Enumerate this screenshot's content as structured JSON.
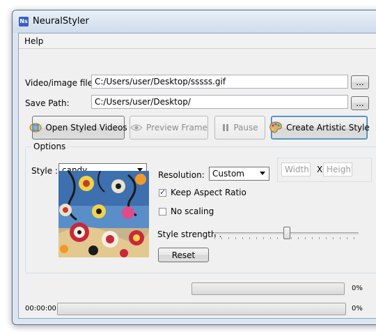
{
  "window": {
    "title": "NeuralStyler",
    "app_icon_text": "Ns"
  },
  "menu": {
    "help": "Help"
  },
  "video_file": {
    "label": "Video/image file:",
    "value": "C:/Users/user/Desktop/sssss.gif",
    "browse_label": "..."
  },
  "save_path": {
    "label": "Save Path:",
    "value": "C:/Users/user/Desktop/",
    "browse_label": "..."
  },
  "toolbar": {
    "open_styled_videos": "Open Styled Videos",
    "preview_frame": "Preview Frame",
    "pause": "Pause",
    "create_artistic_style": "Create Artistic Style"
  },
  "options": {
    "group_title": "Options",
    "style_label": "Style :",
    "style_value": "candy",
    "resolution_label": "Resolution:",
    "resolution_value": "Custom",
    "width_placeholder": "Width",
    "x_separator": "X",
    "height_placeholder": "Height",
    "keep_aspect_label": "Keep Aspect Ratio",
    "keep_aspect_checked": true,
    "no_scaling_label": "No scaling",
    "no_scaling_checked": false,
    "style_strength_label": "Style strength :",
    "style_strength_value": 0.5,
    "reset_label": "Reset"
  },
  "progress": {
    "frame_percent": "0%",
    "total_percent": "0%",
    "elapsed_time": "00:00:00"
  }
}
